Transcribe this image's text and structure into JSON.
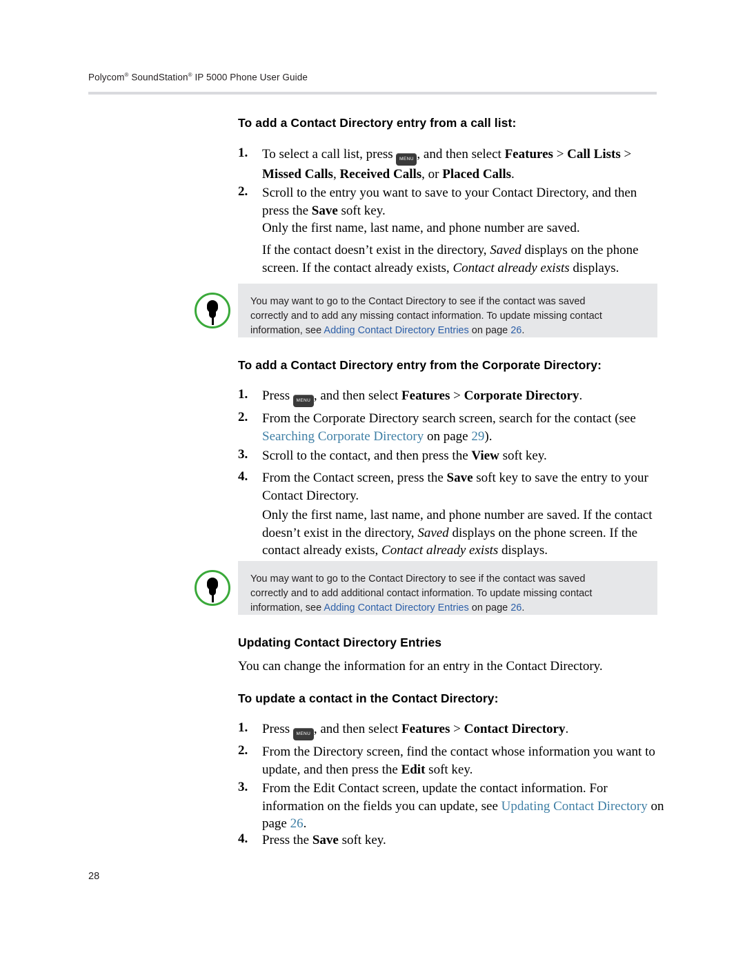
{
  "header": {
    "title_pre": "Polycom",
    "title_reg1": "®",
    "title_mid": " SoundStation",
    "title_reg2": "®",
    "title_post": " IP 5000 Phone User Guide"
  },
  "page_number": "28",
  "sections": {
    "s1_heading": "To add a Contact Directory entry from a call list:",
    "s1_step1_num": "1.",
    "s1_step1_a": "To select a call list, press",
    "s1_step1_key": "MENU",
    "s1_step1_b": ", and then select ",
    "s1_step1_bold1": "Features",
    "s1_step1_c": " > ",
    "s1_step1_bold2": "Call Lists",
    "s1_step1_d": " > ",
    "s1_step1_bold3": "Missed Calls",
    "s1_step1_e": ", ",
    "s1_step1_bold4": "Received Calls",
    "s1_step1_f": ", or ",
    "s1_step1_bold5": "Placed Calls",
    "s1_step1_g": ".",
    "s1_step2_num": "2.",
    "s1_step2_a": "Scroll to the entry you want to save to your Contact Directory, and then press the ",
    "s1_step2_bold": "Save",
    "s1_step2_b": " soft key.",
    "s1_para1": "Only the first name, last name, and phone number are saved.",
    "s1_para2_a": "If the contact doesn’t exist in the directory, ",
    "s1_para2_i1": "Saved",
    "s1_para2_b": " displays on the phone screen. If the contact already exists, ",
    "s1_para2_i2": "Contact already exists",
    "s1_para2_c": " displays."
  },
  "note1": {
    "icon": "pushpin-icon",
    "line1": "You may want to go to the Contact Directory to see if the contact was saved",
    "line2": "correctly and to add any missing contact information. To update missing contact",
    "line3_pre": "information, see ",
    "line3_link": "Adding Contact Directory Entries",
    "line3_mid": " on page ",
    "line3_page": "26",
    "line3_post": "."
  },
  "section2": {
    "heading": "To add a Contact Directory entry from the Corporate Directory:",
    "step1_num": "1.",
    "step1_a": "Press",
    "step1_key": "MENU",
    "step1_b": ", and then select ",
    "step1_bold1": "Features",
    "step1_c": " > ",
    "step1_bold2": "Corporate Directory",
    "step1_d": ".",
    "step2_num": "2.",
    "step2_a": "From the Corporate Directory search screen, search for the contact (see ",
    "step2_link": "Searching Corporate Directory",
    "step2_b": " on page ",
    "step2_page": "29",
    "step2_c": ").",
    "step3_num": "3.",
    "step3_a": "Scroll to the contact, and then press the ",
    "step3_bold": "View",
    "step3_b": " soft key.",
    "step4_num": "4.",
    "step4_a": "From the Contact screen, press the ",
    "step4_bold": "Save",
    "step4_b": " soft key to save the entry to your Contact Directory.",
    "para_a": "Only the first name, last name, and phone number are saved. If the contact doesn’t exist in the directory, ",
    "para_i1": "Saved",
    "para_b": " displays on the phone screen. If the contact already exists, ",
    "para_i2": "Contact already exists",
    "para_c": " displays."
  },
  "note2": {
    "icon": "pushpin-icon",
    "line1": "You may want to go to the Contact Directory to see if the contact was saved",
    "line2": "correctly and to add additional contact information. To update missing contact",
    "line3_pre": "information, see ",
    "line3_link": "Adding Contact Directory Entries",
    "line3_mid": " on page ",
    "line3_page": "26",
    "line3_post": "."
  },
  "section3": {
    "heading": "Updating Contact Directory Entries",
    "intro": "You can change the information for an entry in the Contact Directory.",
    "subheading": "To update a contact in the Contact Directory:",
    "step1_num": "1.",
    "step1_a": "Press",
    "step1_key": "MENU",
    "step1_b": ", and then select ",
    "step1_bold1": "Features",
    "step1_c": " > ",
    "step1_bold2": "Contact Directory",
    "step1_d": ".",
    "step2_num": "2.",
    "step2_a": "From the Directory screen, find the contact whose information you want to update, and then press the ",
    "step2_bold": "Edit",
    "step2_b": " soft key.",
    "step3_num": "3.",
    "step3_a": "From the Edit Contact screen, update the contact information. For information on the fields you can update, see ",
    "step3_link": "Updating Contact Directory",
    "step3_b": " on page ",
    "step3_page": "26",
    "step3_c": ".",
    "step4_num": "4.",
    "step4_a": "Press the ",
    "step4_bold": "Save",
    "step4_b": " soft key."
  }
}
